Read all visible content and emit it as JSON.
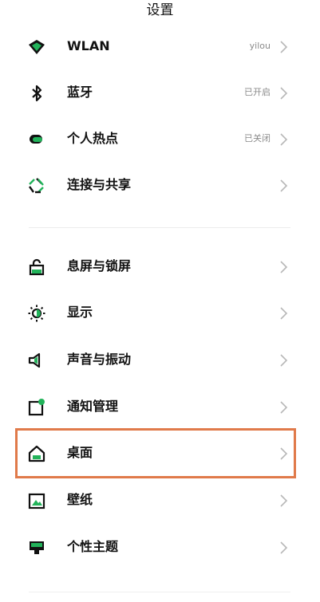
{
  "header": {
    "title": "设置"
  },
  "colors": {
    "accent": "#22b35a",
    "highlight": "#e07a4a",
    "chevron": "#b8b8b8"
  },
  "group1": {
    "items": [
      {
        "label": "WLAN",
        "value": "yilou",
        "icon": "wifi-icon"
      },
      {
        "label": "蓝牙",
        "value": "已开启",
        "icon": "bluetooth-icon"
      },
      {
        "label": "个人热点",
        "value": "已关闭",
        "icon": "hotspot-icon"
      },
      {
        "label": "连接与共享",
        "value": "",
        "icon": "share-icon"
      }
    ]
  },
  "group2": {
    "items": [
      {
        "label": "息屏与锁屏",
        "icon": "lock-icon"
      },
      {
        "label": "显示",
        "icon": "brightness-icon"
      },
      {
        "label": "声音与振动",
        "icon": "speaker-icon"
      },
      {
        "label": "通知管理",
        "icon": "notification-icon"
      },
      {
        "label": "桌面",
        "icon": "home-icon"
      },
      {
        "label": "壁纸",
        "icon": "wallpaper-icon"
      },
      {
        "label": "个性主题",
        "icon": "theme-icon"
      }
    ]
  }
}
